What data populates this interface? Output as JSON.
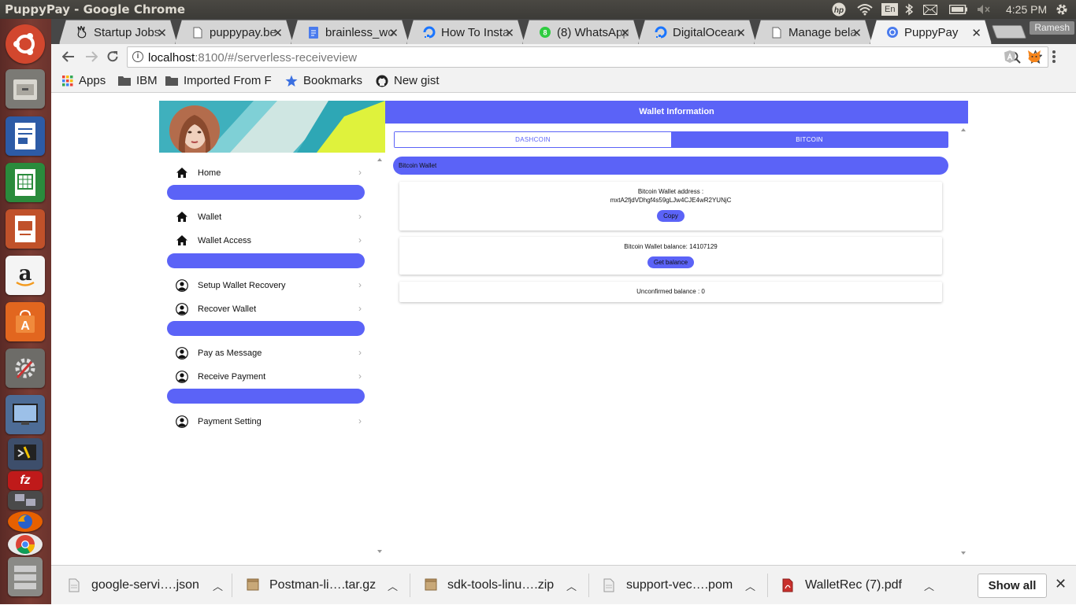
{
  "window": {
    "title": "PuppyPay - Google Chrome"
  },
  "system_tray": {
    "language": "En",
    "clock": "4:25 PM",
    "user": "Ramesh"
  },
  "launcher": {
    "apps": [
      "ubuntu-icon",
      "files-icon",
      "writer-icon",
      "calc-icon",
      "impress-icon",
      "amazon-icon",
      "software-center-icon",
      "settings-icon",
      "screenshot-icon",
      "terminal-icon",
      "filezilla-icon",
      "network-icon",
      "firefox-icon",
      "chrome-icon",
      "drive-icon"
    ]
  },
  "tabs": [
    {
      "title": "Startup Jobs",
      "icon": "angellist-icon"
    },
    {
      "title": "puppypay.be",
      "icon": "page-icon"
    },
    {
      "title": "brainless_wo",
      "icon": "docs-icon"
    },
    {
      "title": "How To Insta",
      "icon": "digitalocean-icon"
    },
    {
      "title": "(8) WhatsApp",
      "icon": "whatsapp-icon"
    },
    {
      "title": "DigitalOcean",
      "icon": "digitalocean-icon"
    },
    {
      "title": "Manage bela",
      "icon": "page-icon"
    },
    {
      "title": "PuppyPay",
      "icon": "chrome-icon",
      "active": true
    }
  ],
  "addressbar": {
    "host": "localhost",
    "path": ":8100/#/serverless-receiveview"
  },
  "bookmarks": [
    {
      "label": "Apps",
      "icon": "apps-grid-icon"
    },
    {
      "label": "IBM",
      "icon": "folder-icon"
    },
    {
      "label": "Imported From F",
      "icon": "folder-icon"
    },
    {
      "label": "Bookmarks",
      "icon": "star-icon"
    },
    {
      "label": "New gist",
      "icon": "github-icon"
    }
  ],
  "menu": {
    "groups": [
      [
        {
          "label": "Home",
          "icon": "home-icon"
        }
      ],
      [
        {
          "label": "Wallet",
          "icon": "home-icon"
        },
        {
          "label": "Wallet Access",
          "icon": "home-icon"
        }
      ],
      [
        {
          "label": "Setup Wallet Recovery",
          "icon": "person-icon"
        },
        {
          "label": "Recover Wallet",
          "icon": "person-icon"
        }
      ],
      [
        {
          "label": "Pay as Message",
          "icon": "person-icon"
        },
        {
          "label": "Receive Payment",
          "icon": "person-icon"
        }
      ],
      [
        {
          "label": "Payment Setting",
          "icon": "person-icon"
        }
      ]
    ]
  },
  "main": {
    "header": "Wallet Information",
    "segments": [
      "DASHCOIN",
      "BITCOIN"
    ],
    "selected_segment": "BITCOIN",
    "wallet_bar": "Bitcoin Wallet",
    "address_label": "Bitcoin Wallet address :",
    "address_value": "mxtA2fjdVDhgf4s59gLJw4CJE4wR2YUNjC",
    "copy_button": "Copy",
    "balance_text": "Bitcoin Wallet balance: 14107129",
    "get_balance_button": "Get balance",
    "unconfirmed_text": "Unconfirmed balance : 0"
  },
  "downloads": {
    "items": [
      {
        "name": "google-servi….json",
        "icon": "file-icon"
      },
      {
        "name": "Postman-li….tar.gz",
        "icon": "archive-icon"
      },
      {
        "name": "sdk-tools-linu….zip",
        "icon": "archive-icon"
      },
      {
        "name": "support-vec….pom",
        "icon": "file-icon"
      },
      {
        "name": "WalletRec (7).pdf",
        "icon": "pdf-icon"
      }
    ],
    "show_all": "Show all"
  },
  "colors": {
    "accent": "#5b63f7",
    "titlebar": "#3c3b37",
    "launcher": "#6a332d"
  }
}
